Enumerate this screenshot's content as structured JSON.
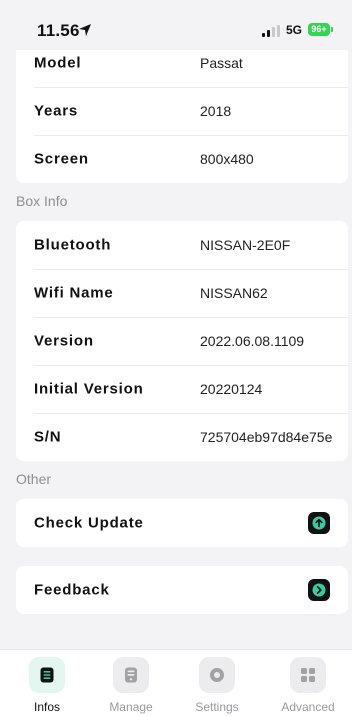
{
  "status_bar": {
    "time": "11.56",
    "network": "5G",
    "battery": "96+"
  },
  "car_info": {
    "rows": [
      {
        "label": "Model",
        "value": "Passat"
      },
      {
        "label": "Years",
        "value": "2018"
      },
      {
        "label": "Screen",
        "value": "800x480"
      }
    ]
  },
  "box_info": {
    "title": "Box Info",
    "rows": [
      {
        "label": "Bluetooth",
        "value": "NISSAN-2E0F"
      },
      {
        "label": "Wifi Name",
        "value": "NISSAN62"
      },
      {
        "label": "Version",
        "value": "2022.06.08.1109"
      },
      {
        "label": "Initial Version",
        "value": "20220124"
      },
      {
        "label": "S/N",
        "value": "725704eb97d84e75e"
      }
    ]
  },
  "other": {
    "title": "Other",
    "check_update_label": "Check Update",
    "feedback_label": "Feedback"
  },
  "tabs": [
    {
      "label": "Infos",
      "icon": "infos-icon"
    },
    {
      "label": "Manage",
      "icon": "manage-icon"
    },
    {
      "label": "Settings",
      "icon": "settings-icon"
    },
    {
      "label": "Advanced",
      "icon": "advanced-icon"
    }
  ],
  "colors": {
    "accent": "#3cc8a0",
    "battery": "#35d454"
  }
}
